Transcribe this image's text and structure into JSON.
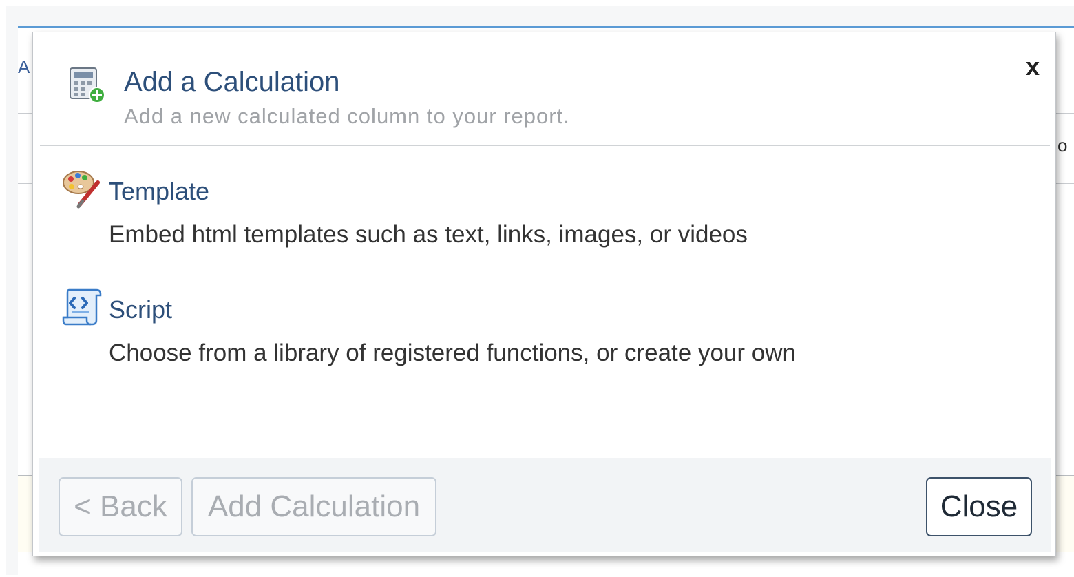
{
  "background": {
    "left_fragment": "A",
    "right_fragment": "o"
  },
  "dialog": {
    "title": "Add a Calculation",
    "subtitle": "Add a new calculated column to your report.",
    "close_x": "x",
    "header_icon": "calculator-add-icon",
    "options": [
      {
        "icon": "palette-brush-icon",
        "title": "Template",
        "description": "Embed html templates such as text, links, images, or videos"
      },
      {
        "icon": "script-icon",
        "title": "Script",
        "description": "Choose from a library of registered functions, or create your own"
      }
    ],
    "footer": {
      "back_label": "< Back",
      "add_label": "Add Calculation",
      "close_label": "Close"
    }
  },
  "colors": {
    "title": "#2d4f7a",
    "subtitle": "#a0a3a7",
    "footer_bg": "#f2f4f6",
    "accent": "#5b9bd5"
  }
}
